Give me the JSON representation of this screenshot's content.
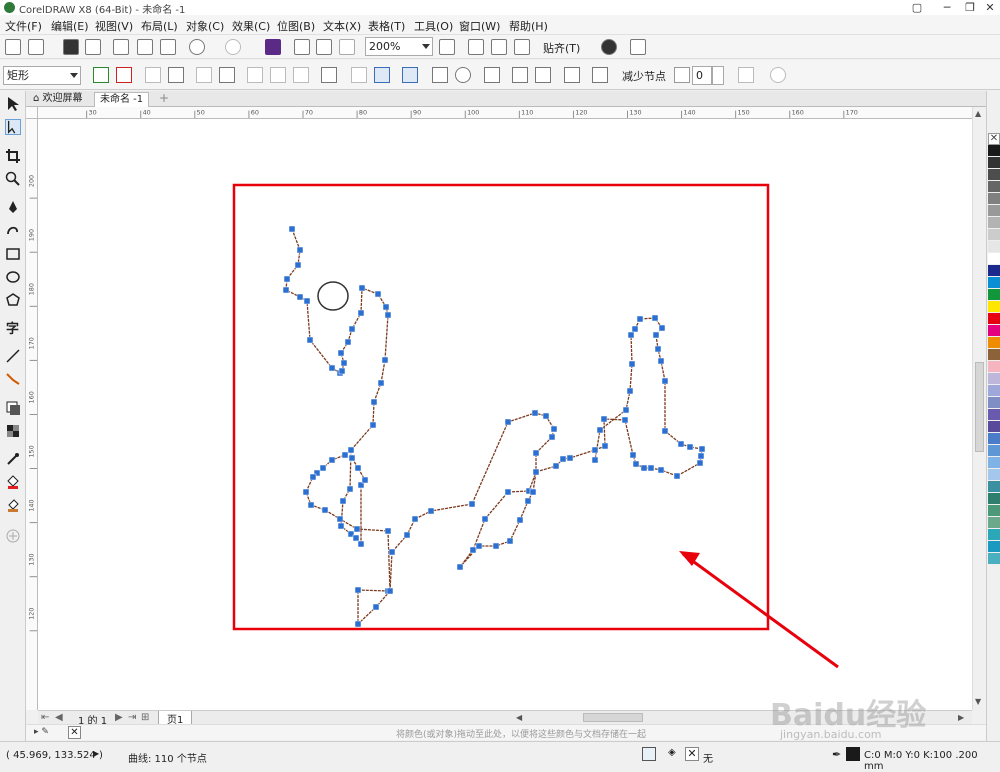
{
  "titlebar": {
    "title": "CorelDRAW X8 (64-Bit) - 未命名 -1"
  },
  "menu": {
    "items": [
      "文件(F)",
      "编辑(E)",
      "视图(V)",
      "布局(L)",
      "对象(C)",
      "效果(C)",
      "位图(B)",
      "文本(X)",
      "表格(T)",
      "工具(O)",
      "窗口(W)",
      "帮助(H)"
    ]
  },
  "toolbar": {
    "zoom_value": "200%",
    "snap_label": "贴齐(T)"
  },
  "property_bar": {
    "shape_combo": "矩形",
    "reduce_nodes_label": "减少节点",
    "smoothing_value": "0"
  },
  "tabs": {
    "welcome": "欢迎屏幕",
    "document": "未命名 -1"
  },
  "rulers": {
    "h_ticks": [
      "30",
      "40",
      "50",
      "60",
      "70",
      "80",
      "90",
      "100",
      "110",
      "120",
      "130",
      "140",
      "150",
      "160",
      "170"
    ],
    "v_ticks": [
      "200",
      "190",
      "180",
      "170",
      "160",
      "150",
      "140",
      "130",
      "120"
    ],
    "unit": "mm"
  },
  "pagebar": {
    "page_count": "1 的 1",
    "page_tab": "页1"
  },
  "hint": {
    "text": "将颜色(或对象)拖动至此处，以便将这些颜色与文档存储在一起"
  },
  "status": {
    "coords": "( 45.969, 133.524 )",
    "object_info": "曲线: 110 个节点",
    "fill_none": "无",
    "outline_info": "C:0 M:0 Y:0 K:100  .200 mm"
  },
  "watermark": {
    "brand": "Baidu经验",
    "url": "jingyan.baidu.com"
  },
  "palette": {
    "colors": [
      "#1a1a1a",
      "#333333",
      "#4d4d4d",
      "#666666",
      "#808080",
      "#999999",
      "#b3b3b3",
      "#cccccc",
      "#e6e6e6",
      "#ffffff",
      "#1b2a8c",
      "#0a8fd6",
      "#12963c",
      "#ffe600",
      "#e60012",
      "#e4007f",
      "#f08c00",
      "#8c6239",
      "#f4b5c0",
      "#bfb7d9",
      "#9fa8da",
      "#7f8fc6",
      "#6a5aad",
      "#5a4a9c",
      "#4a7cc9",
      "#5d97d6",
      "#7fb2e5",
      "#a4c8ec",
      "#3a8fa0",
      "#2e7f6e",
      "#4a9a7a",
      "#6aaa8a",
      "#2aa8b8",
      "#1a9ac0",
      "#4ab0c0"
    ]
  },
  "colors": {
    "selection_box": "#e8000b",
    "node_fill": "#2b6fd1",
    "path_stroke": "#7a3a20",
    "arrow": "#e8000b"
  }
}
